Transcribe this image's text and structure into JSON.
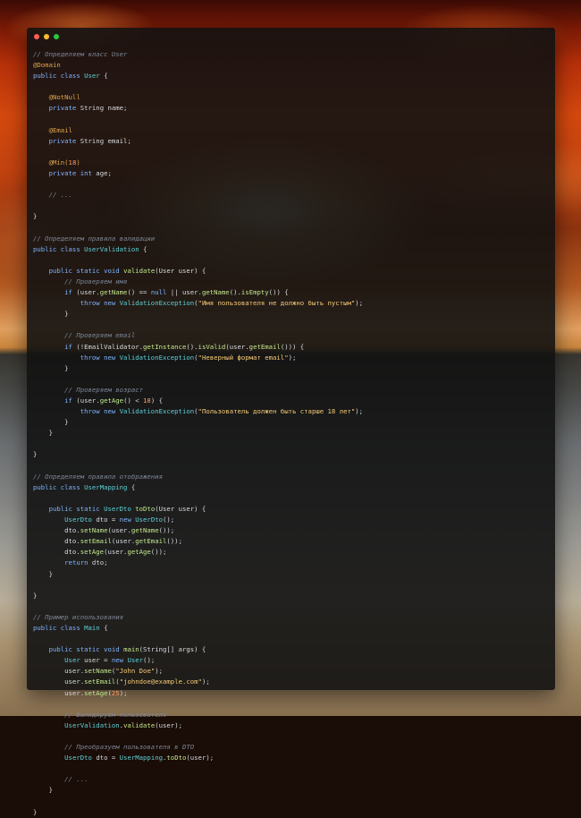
{
  "colors": {
    "dot_red": "#ff5f57",
    "dot_yellow": "#febc2e",
    "dot_green": "#28c840",
    "window_bg": "#121212"
  },
  "window_controls": [
    "close-dot",
    "minimize-dot",
    "maximize-dot"
  ],
  "code_lines": [
    [
      [
        "comment",
        "// Определяем класс User"
      ]
    ],
    [
      [
        "annotation",
        "@Domain"
      ]
    ],
    [
      [
        "keyword",
        "public class "
      ],
      [
        "class",
        "User"
      ],
      [
        "plain",
        " {"
      ]
    ],
    [],
    [
      [
        "plain",
        "    "
      ],
      [
        "annotation",
        "@NotNull"
      ]
    ],
    [
      [
        "plain",
        "    "
      ],
      [
        "keyword",
        "private "
      ],
      [
        "plain",
        "String name;"
      ]
    ],
    [],
    [
      [
        "plain",
        "    "
      ],
      [
        "annotation",
        "@Email"
      ]
    ],
    [
      [
        "plain",
        "    "
      ],
      [
        "keyword",
        "private "
      ],
      [
        "plain",
        "String email;"
      ]
    ],
    [],
    [
      [
        "plain",
        "    "
      ],
      [
        "annotation",
        "@Min("
      ],
      [
        "number",
        "18"
      ],
      [
        "annotation",
        ")"
      ]
    ],
    [
      [
        "plain",
        "    "
      ],
      [
        "keyword",
        "private int "
      ],
      [
        "plain",
        "age;"
      ]
    ],
    [],
    [
      [
        "plain",
        "    "
      ],
      [
        "comment",
        "// ..."
      ]
    ],
    [],
    [
      [
        "plain",
        "}"
      ]
    ],
    [],
    [
      [
        "comment",
        "// Определяем правила валидации"
      ]
    ],
    [
      [
        "keyword",
        "public class "
      ],
      [
        "class",
        "UserValidation"
      ],
      [
        "plain",
        " {"
      ]
    ],
    [],
    [
      [
        "plain",
        "    "
      ],
      [
        "keyword",
        "public static void "
      ],
      [
        "method",
        "validate"
      ],
      [
        "plain",
        "(User user) {"
      ]
    ],
    [
      [
        "plain",
        "        "
      ],
      [
        "comment",
        "// Проверяем имя"
      ]
    ],
    [
      [
        "plain",
        "        "
      ],
      [
        "keyword",
        "if "
      ],
      [
        "plain",
        "(user."
      ],
      [
        "method",
        "getName"
      ],
      [
        "plain",
        "() == "
      ],
      [
        "keyword",
        "null"
      ],
      [
        "plain",
        " || user."
      ],
      [
        "method",
        "getName"
      ],
      [
        "plain",
        "()."
      ],
      [
        "method",
        "isEmpty"
      ],
      [
        "plain",
        "()) {"
      ]
    ],
    [
      [
        "plain",
        "            "
      ],
      [
        "keyword",
        "throw new "
      ],
      [
        "class",
        "ValidationException"
      ],
      [
        "plain",
        "("
      ],
      [
        "string",
        "\"Имя пользователя не должно быть пустым\""
      ],
      [
        "plain",
        ");"
      ]
    ],
    [
      [
        "plain",
        "        }"
      ]
    ],
    [],
    [
      [
        "plain",
        "        "
      ],
      [
        "comment",
        "// Проверяем email"
      ]
    ],
    [
      [
        "plain",
        "        "
      ],
      [
        "keyword",
        "if "
      ],
      [
        "plain",
        "(!EmailValidator."
      ],
      [
        "method",
        "getInstance"
      ],
      [
        "plain",
        "()."
      ],
      [
        "method",
        "isValid"
      ],
      [
        "plain",
        "(user."
      ],
      [
        "method",
        "getEmail"
      ],
      [
        "plain",
        "())) {"
      ]
    ],
    [
      [
        "plain",
        "            "
      ],
      [
        "keyword",
        "throw new "
      ],
      [
        "class",
        "ValidationException"
      ],
      [
        "plain",
        "("
      ],
      [
        "string",
        "\"Неверный формат email\""
      ],
      [
        "plain",
        ");"
      ]
    ],
    [
      [
        "plain",
        "        }"
      ]
    ],
    [],
    [
      [
        "plain",
        "        "
      ],
      [
        "comment",
        "// Проверяем возраст"
      ]
    ],
    [
      [
        "plain",
        "        "
      ],
      [
        "keyword",
        "if "
      ],
      [
        "plain",
        "(user."
      ],
      [
        "method",
        "getAge"
      ],
      [
        "plain",
        "() < "
      ],
      [
        "number",
        "18"
      ],
      [
        "plain",
        ") {"
      ]
    ],
    [
      [
        "plain",
        "            "
      ],
      [
        "keyword",
        "throw new "
      ],
      [
        "class",
        "ValidationException"
      ],
      [
        "plain",
        "("
      ],
      [
        "string",
        "\"Пользователь должен быть старше 18 лет\""
      ],
      [
        "plain",
        ");"
      ]
    ],
    [
      [
        "plain",
        "        }"
      ]
    ],
    [
      [
        "plain",
        "    }"
      ]
    ],
    [],
    [
      [
        "plain",
        "}"
      ]
    ],
    [],
    [
      [
        "comment",
        "// Определяем правила отображения"
      ]
    ],
    [
      [
        "keyword",
        "public class "
      ],
      [
        "class",
        "UserMapping"
      ],
      [
        "plain",
        " {"
      ]
    ],
    [],
    [
      [
        "plain",
        "    "
      ],
      [
        "keyword",
        "public static "
      ],
      [
        "class",
        "UserDto "
      ],
      [
        "method",
        "toDto"
      ],
      [
        "plain",
        "(User user) {"
      ]
    ],
    [
      [
        "plain",
        "        "
      ],
      [
        "class",
        "UserDto "
      ],
      [
        "plain",
        "dto = "
      ],
      [
        "keyword",
        "new "
      ],
      [
        "class",
        "UserDto"
      ],
      [
        "plain",
        "();"
      ]
    ],
    [
      [
        "plain",
        "        dto."
      ],
      [
        "method",
        "setName"
      ],
      [
        "plain",
        "(user."
      ],
      [
        "method",
        "getName"
      ],
      [
        "plain",
        "());"
      ]
    ],
    [
      [
        "plain",
        "        dto."
      ],
      [
        "method",
        "setEmail"
      ],
      [
        "plain",
        "(user."
      ],
      [
        "method",
        "getEmail"
      ],
      [
        "plain",
        "());"
      ]
    ],
    [
      [
        "plain",
        "        dto."
      ],
      [
        "method",
        "setAge"
      ],
      [
        "plain",
        "(user."
      ],
      [
        "method",
        "getAge"
      ],
      [
        "plain",
        "());"
      ]
    ],
    [
      [
        "plain",
        "        "
      ],
      [
        "keyword",
        "return "
      ],
      [
        "plain",
        "dto;"
      ]
    ],
    [
      [
        "plain",
        "    }"
      ]
    ],
    [],
    [
      [
        "plain",
        "}"
      ]
    ],
    [],
    [
      [
        "comment",
        "// Пример использования"
      ]
    ],
    [
      [
        "keyword",
        "public class "
      ],
      [
        "class",
        "Main"
      ],
      [
        "plain",
        " {"
      ]
    ],
    [],
    [
      [
        "plain",
        "    "
      ],
      [
        "keyword",
        "public static void "
      ],
      [
        "method",
        "main"
      ],
      [
        "plain",
        "(String[] args) {"
      ]
    ],
    [
      [
        "plain",
        "        "
      ],
      [
        "class",
        "User "
      ],
      [
        "plain",
        "user = "
      ],
      [
        "keyword",
        "new "
      ],
      [
        "class",
        "User"
      ],
      [
        "plain",
        "();"
      ]
    ],
    [
      [
        "plain",
        "        user."
      ],
      [
        "method",
        "setName"
      ],
      [
        "plain",
        "("
      ],
      [
        "string",
        "\"John Doe\""
      ],
      [
        "plain",
        ");"
      ]
    ],
    [
      [
        "plain",
        "        user."
      ],
      [
        "method",
        "setEmail"
      ],
      [
        "plain",
        "("
      ],
      [
        "string",
        "\"johndoe@example.com\""
      ],
      [
        "plain",
        ");"
      ]
    ],
    [
      [
        "plain",
        "        user."
      ],
      [
        "method",
        "setAge"
      ],
      [
        "plain",
        "("
      ],
      [
        "number",
        "25"
      ],
      [
        "plain",
        ");"
      ]
    ],
    [],
    [
      [
        "plain",
        "        "
      ],
      [
        "comment",
        "// Валидируем пользователя"
      ]
    ],
    [
      [
        "plain",
        "        "
      ],
      [
        "class",
        "UserValidation"
      ],
      [
        "plain",
        "."
      ],
      [
        "method",
        "validate"
      ],
      [
        "plain",
        "(user);"
      ]
    ],
    [],
    [
      [
        "plain",
        "        "
      ],
      [
        "comment",
        "// Преобразуем пользователя в DTO"
      ]
    ],
    [
      [
        "plain",
        "        "
      ],
      [
        "class",
        "UserDto "
      ],
      [
        "plain",
        "dto = "
      ],
      [
        "class",
        "UserMapping"
      ],
      [
        "plain",
        "."
      ],
      [
        "method",
        "toDto"
      ],
      [
        "plain",
        "(user);"
      ]
    ],
    [],
    [
      [
        "plain",
        "        "
      ],
      [
        "comment",
        "// ..."
      ]
    ],
    [
      [
        "plain",
        "    }"
      ]
    ],
    [],
    [
      [
        "plain",
        "}"
      ]
    ]
  ]
}
